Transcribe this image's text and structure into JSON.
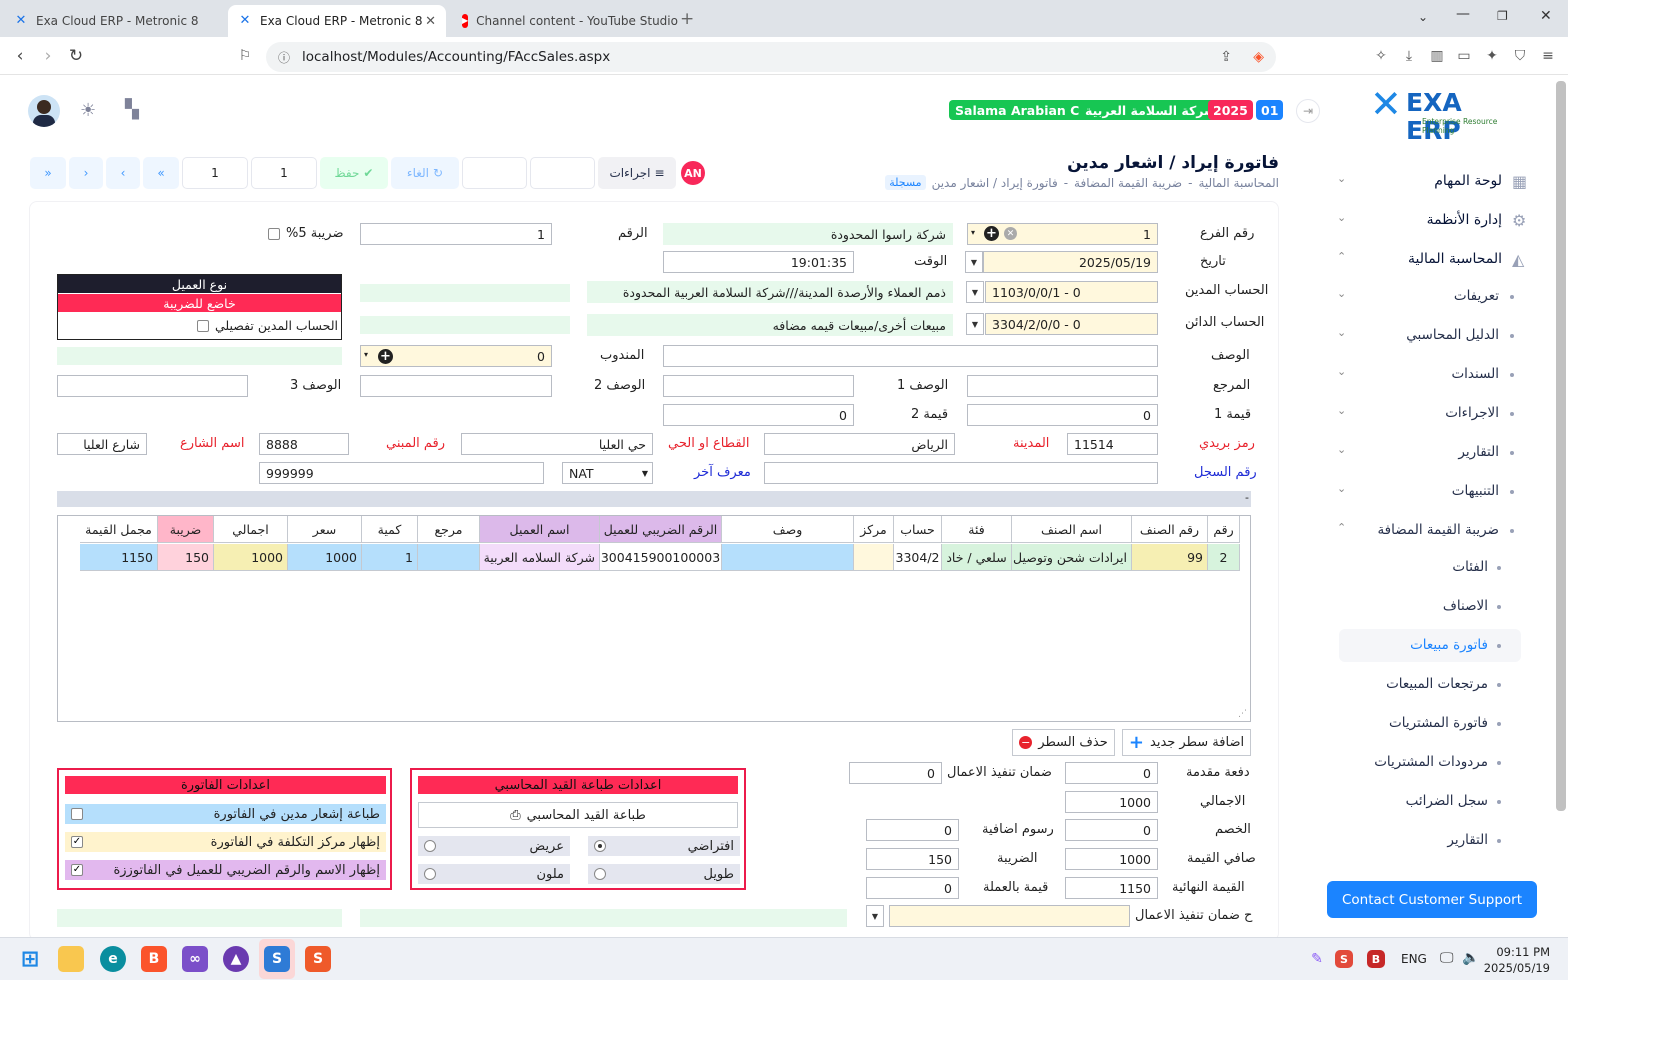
{
  "browser": {
    "tabs": [
      {
        "title": "Exa Cloud ERP - Metronic 8"
      },
      {
        "title": "Exa Cloud ERP - Metronic 8"
      },
      {
        "title": "Channel content - YouTube Studio"
      }
    ],
    "url": "localhost/Modules/Accounting/FAccSales.aspx"
  },
  "header": {
    "brand": "EXA ERP",
    "brand_sub": "Enterprise Resource Planning",
    "badges": {
      "company_en": "Salama Arabian Co",
      "company_ar": "شركة السلامة العربية",
      "year": "2025",
      "branch": "01"
    },
    "user_initials": "AN"
  },
  "titlebar": {
    "title": "فاتورة إيراد / اشعار مدين",
    "breadcrumb": [
      "المحاسبة المالية",
      "ضريبة القيمة المضافة",
      "فاتورة إيراد / اشعار مدين"
    ],
    "status": "مسجلة",
    "actions_label": "اجراءات",
    "cancel_label": "الغاء",
    "save_label": "حفظ",
    "pager": {
      "page_a": "1",
      "page_b": "1"
    }
  },
  "form": {
    "branch_no_label": "رقم الفرع",
    "branch_no": "1",
    "branch_name": "شركة راسوا المحدودة",
    "number_label": "الرقم",
    "number": "1",
    "tax_label": "ضريبة 5%",
    "date_label": "تاريخ",
    "date": "2025/05/19",
    "time_label": "الوقت",
    "time": "19:01:35",
    "debit_label": "الحساب المدين",
    "debit_code": "1103/0/0/1 - 0",
    "debit_name": "ذمم العملاء والأرصدة المدينة///شركة السلامة العربية المحدودة",
    "credit_label": "الحساب الدائن",
    "credit_code": "3304/2/0/0 - 0",
    "credit_name": "مبيعات أخرى/مبيعات قيمه مضافه",
    "desc_label": "الوصف",
    "rep_label": "المندوب",
    "rep_value": "0",
    "ref_label": "المرجع",
    "desc1_label": "الوصف 1",
    "desc2_label": "الوصف 2",
    "desc3_label": "الوصف 3",
    "val1_label": "قيمة 1",
    "val1": "0",
    "val2_label": "قيمة 2",
    "val2": "0",
    "postal_label": "رمز بريدي",
    "postal": "11514",
    "city_label": "المدينة",
    "city": "الرياض",
    "district_label": "القطاع او الحي",
    "district": "حي العليا",
    "building_label": "رقم المبني",
    "building": "8888",
    "street_label": "اسم الشارع",
    "street": "شارع العليا",
    "record_label": "رقم السجل",
    "other_id_label": "معرف آخر",
    "other_id_type": "NAT",
    "other_id": "999999",
    "customer_type": {
      "header": "نوع العميل",
      "value": "خاضع للضريبة",
      "detail_label": "الحساب المدين تفصيلي"
    },
    "divider_text": "-"
  },
  "grid": {
    "headers": [
      "رقم",
      "رقم الصنف",
      "اسم الصنف",
      "فئة",
      "حساب",
      "مركز",
      "وصف",
      "الرقم الضريبي للعميل",
      "اسم العميل",
      "مرجع",
      "كمية",
      "سعر",
      "اجمالي",
      "ضريبة",
      "مجمل القيمة"
    ],
    "rows": [
      [
        "2",
        "99",
        "ايرادات شحن وتوصيل",
        "سلعي / خاد",
        "3304/2",
        "",
        "",
        "300415900100003",
        "شركة السلامه العربية",
        "",
        "1",
        "1000",
        "1000",
        "150",
        "1150"
      ]
    ]
  },
  "row_buttons": {
    "add": "اضافة سطر جديد",
    "delete": "حذف السطر"
  },
  "totals": {
    "advance_label": "دفعة مقدمة",
    "advance": "0",
    "guarantee_label": "ضمان تنفيذ الاعمال",
    "guarantee": "0",
    "total_label": "الاجمالي",
    "total": "1000",
    "discount_label": "الخصم",
    "discount": "0",
    "fees_label": "رسوم اضافية",
    "fees": "0",
    "net_label": "صافي القيمة",
    "net": "1000",
    "tax_label": "الضريبة",
    "tax": "150",
    "final_label": "القيمة النهائية",
    "final": "1150",
    "currency_label": "قيمة بالعملة",
    "currency": "0",
    "guarantee_acc_label": "ح ضمان تنفيذ الاعمال"
  },
  "print_panel": {
    "title": "اعدادات طباعة القيد المحاسبي",
    "print_btn": "طباعة القيد المحاسبي",
    "default": "افتراضي",
    "wide": "عريض",
    "long": "طويل",
    "color": "ملون"
  },
  "invoice_panel": {
    "title": "اعدادات الفاتورة",
    "opt1": "طباعة إشعار مدين في الفاتورة",
    "opt2": "إظهار مركز التكلفة في الفاتورة",
    "opt3": "إظهار الاسم والرقم الضريبي للعميل في الفاتوززة"
  },
  "sidebar": {
    "items": [
      "لوحة المهام",
      "إدارة الأنظمة",
      "المحاسبة المالية",
      "تعريفات",
      "الدليل المحاسبي",
      "السندات",
      "الاجراءات",
      "التقارير",
      "التنبيهات",
      "ضريبة القيمة المضافة",
      "الفئات",
      "الاصناف",
      "فاتورة مبيعات",
      "مرتجعات المبيعات",
      "فاتورة المشتريات",
      "مردودات المشتريات",
      "سجل الضرائب",
      "التقارير"
    ],
    "support": "Contact Customer Support"
  },
  "taskbar": {
    "lang": "ENG",
    "time": "09:11 PM",
    "date": "2025/05/19"
  }
}
